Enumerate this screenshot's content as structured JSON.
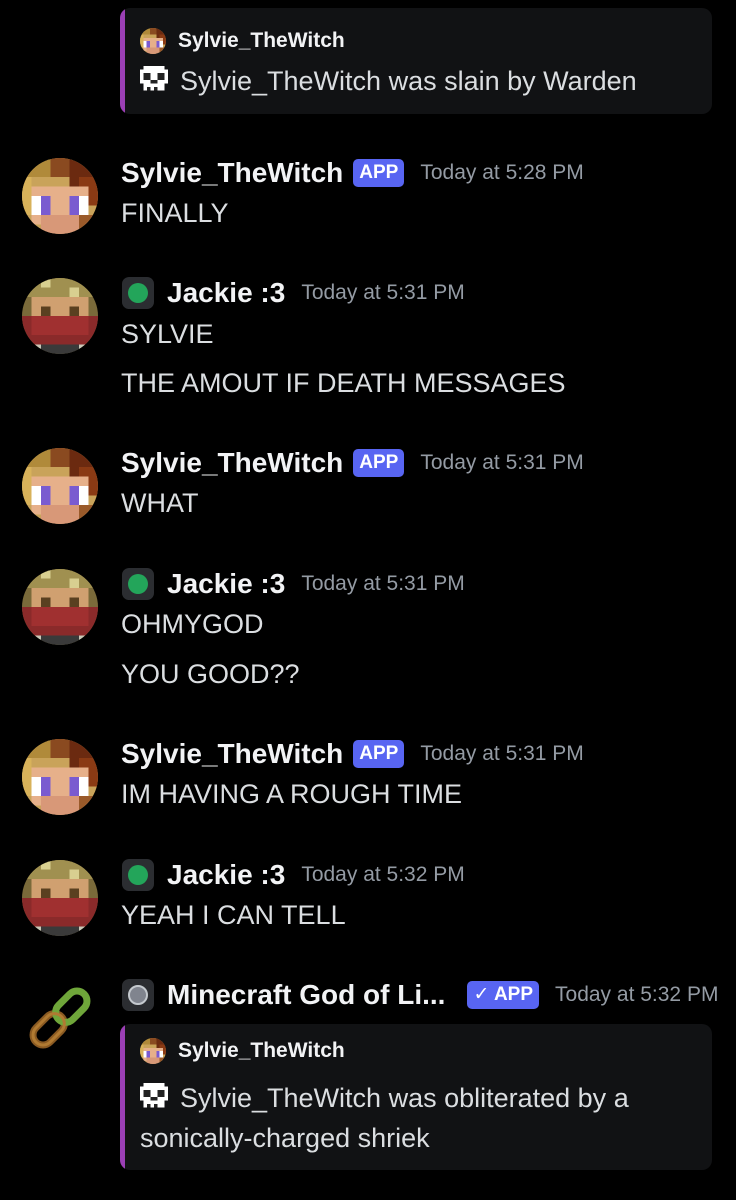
{
  "colors": {
    "background": "#000000",
    "embed_background": "#111214",
    "embed_bar": "#9b3fb5",
    "app_badge": "#5865f2",
    "online_status": "#23a55a",
    "timestamp": "#949ba4"
  },
  "embed_top": {
    "author": "Sylvie_TheWitch",
    "icon": "skull-icon",
    "description": "Sylvie_TheWitch was slain by Warden"
  },
  "messages": [
    {
      "username": "Sylvie_TheWitch",
      "badge": "APP",
      "timestamp": "Today at 5:28 PM",
      "lines": [
        "FINALLY"
      ]
    },
    {
      "username": "Jackie :3",
      "status_icon": "online-status-icon",
      "timestamp": "Today at 5:31 PM",
      "lines": [
        "SYLVIE",
        "THE AMOUT IF DEATH MESSAGES"
      ]
    },
    {
      "username": "Sylvie_TheWitch",
      "badge": "APP",
      "timestamp": "Today at 5:31 PM",
      "lines": [
        "WHAT"
      ]
    },
    {
      "username": "Jackie :3",
      "status_icon": "online-status-icon",
      "timestamp": "Today at 5:31 PM",
      "lines": [
        "OHMYGOD",
        "YOU GOOD??"
      ]
    },
    {
      "username": "Sylvie_TheWitch",
      "badge": "APP",
      "timestamp": "Today at 5:31 PM",
      "lines": [
        "IM HAVING A ROUGH TIME"
      ]
    },
    {
      "username": "Jackie :3",
      "status_icon": "online-status-icon",
      "timestamp": "Today at 5:32 PM",
      "lines": [
        "YEAH I CAN TELL"
      ]
    },
    {
      "username": "Minecraft God of Li...",
      "status_icon": "idle-status-icon",
      "avatar_icon": "chain-link-icon",
      "badge": "✓ APP",
      "timestamp": "Today at 5:32 PM",
      "embed": {
        "author": "Sylvie_TheWitch",
        "icon": "skull-icon",
        "description_line1": "Sylvie_TheWitch was obliterated by a",
        "description_line2": "sonically-charged shriek"
      }
    }
  ]
}
